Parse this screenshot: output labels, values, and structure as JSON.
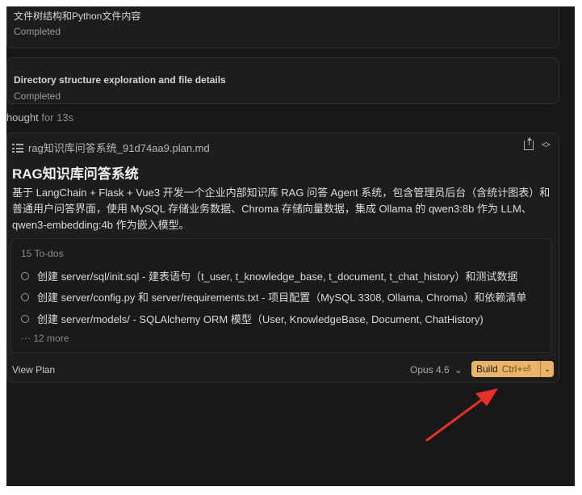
{
  "tasks": [
    {
      "title": "文件树结构和Python文件内容",
      "status": "Completed"
    },
    {
      "title": "Directory structure exploration and file details",
      "status": "Completed"
    }
  ],
  "thought": {
    "label": "Thought",
    "duration": "for 13s"
  },
  "plan": {
    "filename": "rag知识库问答系统_91d74aa9.plan.md",
    "title": "RAG知识库问答系统",
    "description": "基于 LangChain + Flask + Vue3 开发一个企业内部知识库 RAG 问答 Agent 系统，包含管理员后台（含统计图表）和普通用户问答界面，使用 MySQL 存储业务数据、Chroma 存储向量数据，集成 Ollama 的 qwen3:8b 作为 LLM、qwen3-embedding:4b 作为嵌入模型。",
    "todos_count": "15 To-dos",
    "todos": [
      "创建 server/sql/init.sql - 建表语句（t_user, t_knowledge_base, t_document, t_chat_history）和测试数据",
      "创建 server/config.py 和 server/requirements.txt - 项目配置（MySQL 3308, Ollama, Chroma）和依赖清单",
      "创建 server/models/ - SQLAlchemy ORM 模型（User, KnowledgeBase, Document, ChatHistory)"
    ],
    "more": "12 more",
    "view_plan": "View Plan",
    "model": "Opus 4.6",
    "build_label": "Build",
    "build_shortcut": "Ctrl+⏎"
  },
  "colors": {
    "background": "#181818",
    "accent": "#e9b56a",
    "arrow": "#e8302b"
  }
}
